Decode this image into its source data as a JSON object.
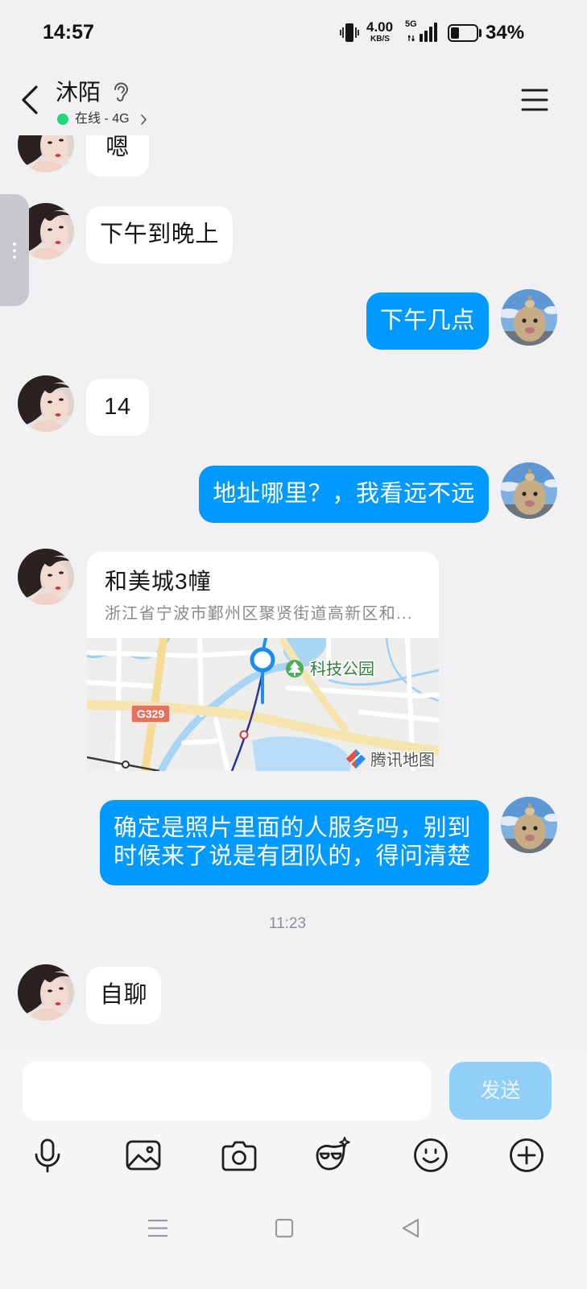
{
  "status_bar": {
    "time": "14:57",
    "net_speed": "4.00",
    "net_speed_unit": "KB/S",
    "network_type": "5G",
    "battery_text": "34%",
    "battery_level": 0.34,
    "icons": [
      "vibrate-icon",
      "signal-icon",
      "battery-icon"
    ]
  },
  "header": {
    "title": "沐陌",
    "status": "在线 - 4G",
    "icons": [
      "back-chevron-icon",
      "ear-icon",
      "chevron-right-icon",
      "menu-icon"
    ]
  },
  "messages": [
    {
      "outgoing": false,
      "text": "嗯"
    },
    {
      "outgoing": false,
      "text": "下午到晚上"
    },
    {
      "outgoing": true,
      "text": "下午几点"
    },
    {
      "outgoing": false,
      "text": "14"
    },
    {
      "outgoing": true,
      "text": "地址哪里？，我看远不远"
    },
    {
      "outgoing": false,
      "location": {
        "title": "和美城3幢",
        "address": "浙江省宁波市鄞州区聚贤街道高新区和...",
        "map_labels": {
          "poi": "科技公园",
          "road": "G329",
          "provider": "腾讯地图"
        }
      }
    },
    {
      "outgoing": true,
      "lines": [
        "确定是照片里面的人服务吗，别到",
        "时候来了说是有团队的，得问清楚"
      ]
    },
    {
      "time_divider": "11:23"
    },
    {
      "outgoing": false,
      "text": "自聊"
    }
  ],
  "composer": {
    "send_label": "发送"
  },
  "toolbar": [
    "mic-icon",
    "image-icon",
    "camera-icon",
    "fun-effects-icon",
    "emoji-icon",
    "plus-icon"
  ],
  "nav_bar": [
    "recents-icon",
    "home-icon",
    "back-icon"
  ],
  "colors": {
    "background": "#f1f1f4",
    "accent": "#0099ff",
    "bubble_incoming": "#ffffff",
    "send_disabled": "#92cff8",
    "online": "#22d67a"
  }
}
